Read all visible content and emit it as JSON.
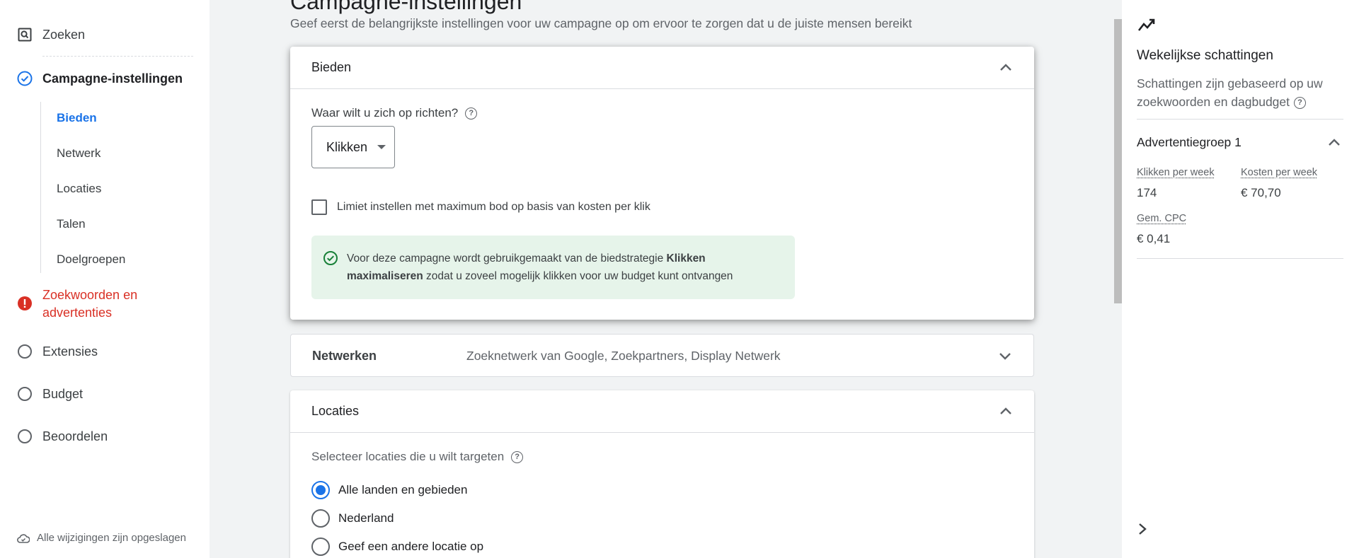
{
  "sidebar": {
    "items": [
      {
        "label": "Zoeken",
        "icon": "search-box-icon"
      },
      {
        "label": "Campagne-instellingen",
        "icon": "check-circle-icon",
        "status": "done"
      },
      {
        "label": "Zoekwoorden en advertenties",
        "icon": "error-icon",
        "status": "error"
      },
      {
        "label": "Extensies",
        "icon": "empty-circle-icon"
      },
      {
        "label": "Budget",
        "icon": "empty-circle-icon"
      },
      {
        "label": "Beoordelen",
        "icon": "empty-circle-icon"
      }
    ],
    "subitems": [
      "Bieden",
      "Netwerk",
      "Locaties",
      "Talen",
      "Doelgroepen"
    ],
    "active_subitem": "Bieden",
    "saved_status": "Alle wijzigingen zijn opgeslagen"
  },
  "main": {
    "title": "Campagne-instellingen",
    "subtitle": "Geef eerst de belangrijkste instellingen voor uw campagne op om ervoor te zorgen dat u de juiste mensen bereikt",
    "bidding": {
      "header": "Bieden",
      "question": "Waar wilt u zich op richten?",
      "select_value": "Klikken",
      "checkbox_label": "Limiet instellen met maximum bod op basis van kosten per klik",
      "checkbox_checked": false,
      "info_prefix": "Voor deze campagne wordt gebruikgemaakt van de biedstrategie ",
      "info_bold": "Klikken maximaliseren",
      "info_suffix": " zodat u zoveel mogelijk klikken voor uw budget kunt ontvangen"
    },
    "networks": {
      "header": "Netwerken",
      "summary": "Zoeknetwerk van Google, Zoekpartners, Display Netwerk"
    },
    "locations": {
      "header": "Locaties",
      "prompt": "Selecteer locaties die u wilt targeten",
      "options": [
        "Alle landen en gebieden",
        "Nederland",
        "Geef een andere locatie op"
      ],
      "selected": "Alle landen en gebieden"
    }
  },
  "estimates": {
    "title": "Wekelijkse schattingen",
    "description": "Schattingen zijn gebaseerd op uw zoekwoorden en dagbudget",
    "ad_group": "Advertentiegroep 1",
    "clicks_label": "Klikken per week",
    "clicks_value": "174",
    "cost_label": "Kosten per week",
    "cost_value": "€ 70,70",
    "cpc_label": "Gem. CPC",
    "cpc_value": "€ 0,41"
  },
  "colors": {
    "accent": "#1a73e8",
    "error": "#d93025",
    "success_bg": "#e6f4ea",
    "success": "#188038"
  }
}
